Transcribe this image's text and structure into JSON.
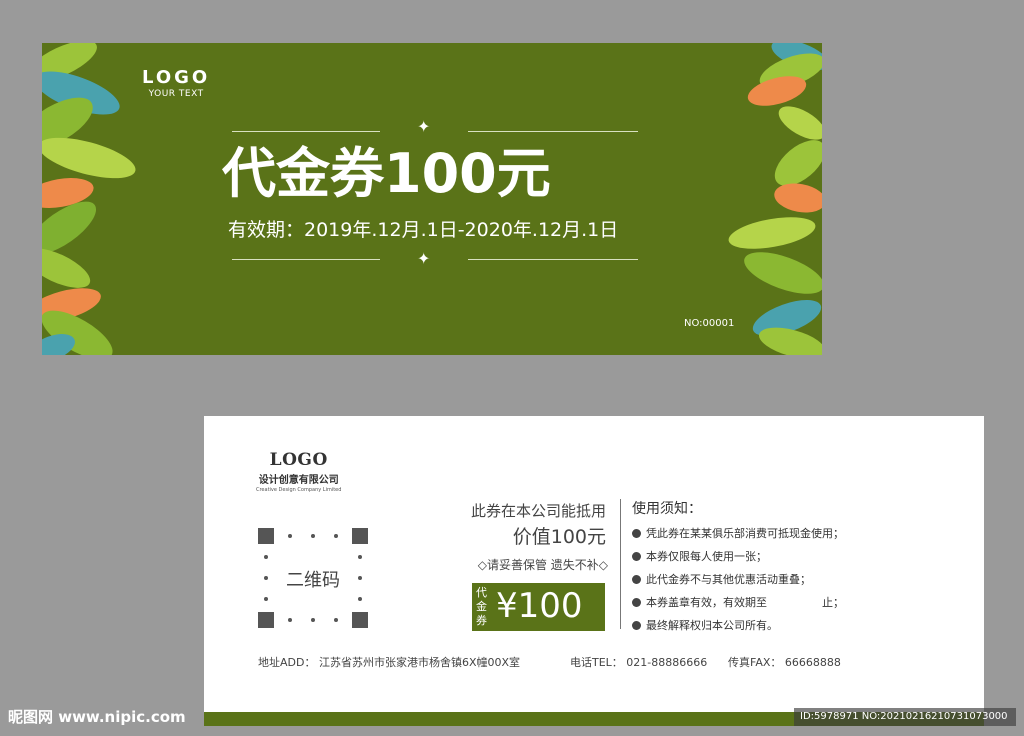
{
  "colors": {
    "card_green": "#5a7318",
    "page_bg": "#9a9a9a",
    "leaf_orange": "#ee8a4a",
    "leaf_light_green": "#9cc43a",
    "leaf_teal": "#4aa2ae"
  },
  "front": {
    "logo": "LOGO",
    "logo_sub": "YOUR TEXT",
    "title": "代金券100元",
    "validity": "有效期：2019年.12月.1日-2020年.12月.1日",
    "serial": "NO:00001",
    "star_icon": "✦"
  },
  "back": {
    "logo": "LOGO",
    "company_cn": "设计创意有限公司",
    "company_en": "Creative Design Company Limited",
    "qr_label": "二维码",
    "offer_line1": "此券在本公司能抵用",
    "offer_line2": "价值100元",
    "offer_line3": "◇请妥善保管 遗失不补◇",
    "stamp_label": "代金券",
    "stamp_amount": "¥100",
    "notice_title": "使用须知：",
    "notices": [
      "凭此券在某某俱乐部消费可抵现金使用；",
      "本券仅限每人使用一张；",
      "此代金券不与其他优惠活动重叠；",
      "本券盖章有效，有效期至　　　　　止；",
      "最终解释权归本公司所有。"
    ],
    "address": "地址ADD：  江苏省苏州市张家港市杨舍镇6X幢00X室",
    "phone": "电话TEL：  021-88886666",
    "fax": "传真FAX：  66668888"
  },
  "watermark": {
    "site": "昵图网 www.nipic.com",
    "id": "ID:5978971 NO:20210216210731073000"
  }
}
